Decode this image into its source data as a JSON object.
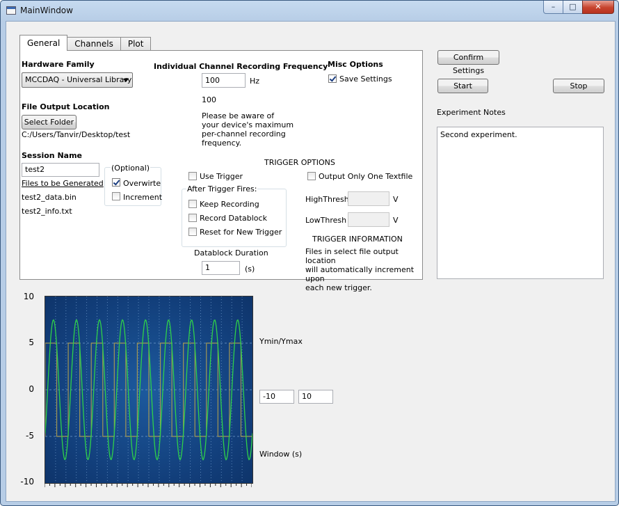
{
  "window": {
    "title": "MainWindow"
  },
  "tabs": [
    {
      "label": "General"
    },
    {
      "label": "Channels"
    },
    {
      "label": "Plot"
    }
  ],
  "general": {
    "hardware_family_label": "Hardware Family",
    "hardware_family_value": "MCCDAQ - Universal Library",
    "freq_label": "Individual Channel Recording Frequency",
    "freq_value": "100",
    "freq_unit": "Hz",
    "freq_display": "100",
    "freq_warning": [
      "Please be aware of",
      "your device's maximum",
      "per-channel recording",
      "frequency."
    ],
    "misc_label": "Misc Options",
    "save_settings_label": "Save Settings",
    "save_settings_checked": true,
    "file_output_label": "File Output Location",
    "select_folder_label": "Select Folder",
    "folder_path": "C:/Users/Tanvir/Desktop/test",
    "session_name_label": "Session Name",
    "session_name_value": "test2",
    "optional_label": "(Optional)",
    "overwrite_label": "Overwirte",
    "overwrite_checked": true,
    "increment_label": "Increment",
    "increment_checked": false,
    "files_header": "Files to be Generated",
    "files": [
      "test2_data.bin",
      "test2_info.txt"
    ],
    "trigger_options_label": "TRIGGER OPTIONS",
    "use_trigger_label": "Use Trigger",
    "output_one_label": "Output Only One Textfile",
    "after_trigger_label": "After Trigger Fires:",
    "keep_recording_label": "Keep Recording",
    "record_datablock_label": "Record Datablock",
    "reset_trigger_label": "Reset for New Trigger",
    "highthresh_label": "HighThresh",
    "lowthresh_label": "LowThresh",
    "volt_unit": "V",
    "trigger_info_label": "TRIGGER INFORMATION",
    "trigger_info_text": [
      "Files in select file output location",
      "will automatically increment upon",
      "each new trigger."
    ],
    "datablock_label": "Datablock Duration",
    "datablock_value": "1",
    "seconds_unit": "(s)"
  },
  "right_panel": {
    "confirm_label": "Confirm Settings",
    "start_label": "Start",
    "stop_label": "Stop",
    "notes_label": "Experiment Notes",
    "notes_text": "Second experiment."
  },
  "plot_controls": {
    "yminmax_label": "Ymin/Ymax",
    "ymin_value": "-10",
    "ymax_value": "10",
    "window_label": "Window (s)"
  },
  "colors": {
    "plot_bg": "#134785",
    "sine": "#2fd14a",
    "square": "#b0a050",
    "grid": "#6c97c8"
  },
  "chart_data": {
    "type": "line",
    "ylim": [
      -10,
      10
    ],
    "yticks": [
      "10",
      "5",
      "0",
      "-5",
      "-10"
    ],
    "grid": true,
    "series": [
      {
        "shape": "sine",
        "amplitude": 7.5,
        "cycles": 9
      },
      {
        "shape": "square",
        "amplitude": 5,
        "cycles": 9
      }
    ]
  }
}
